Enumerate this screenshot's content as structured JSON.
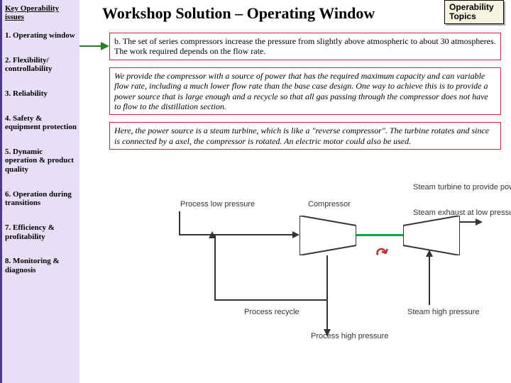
{
  "sidebar": {
    "heading": "Key Operability issues",
    "items": [
      "1. Operating window",
      "2. Flexibility/ controllability",
      "3. Reliability",
      "4. Safety & equipment protection",
      "5. Dynamic operation & product quality",
      "6. Operation during transitions",
      "7. Efficiency & profitability",
      "8. Monitoring & diagnosis"
    ]
  },
  "title": "Workshop Solution – Operating Window",
  "topics_btn": "Operability Topics",
  "boxes": {
    "b1": "b.  The set of series compressors increase the pressure from slightly above atmospheric to about 30 atmospheres.  The work required depends on the flow rate.",
    "b2": "We provide the compressor with a source of power that has the required maximum capacity and can variable flow rate, including a much lower flow rate than the base case design.  One way to achieve this is to provide a power source that is large enough and a recycle so that all gas passing through the compressor does not have to flow to the distillation section.",
    "b3": "Here, the power source is a steam turbine, which is like a \"reverse compressor\".  The turbine rotates and since is connected by a axel, the compressor is rotated.  An electric motor could also be used."
  },
  "diagram": {
    "process_low": "Process low pressure",
    "compressor": "Compressor",
    "steam_turbine": "Steam turbine to provide power",
    "steam_exhaust": "Steam exhaust at low pressure",
    "process_recycle": "Process recycle",
    "steam_high": "Steam high pressure",
    "process_high": "Process high pressure"
  }
}
